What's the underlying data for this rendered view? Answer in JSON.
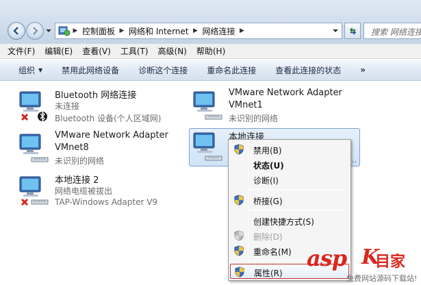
{
  "address_bar": {
    "crumbs": [
      "控制面板",
      "网络和 Internet",
      "网络连接"
    ],
    "search_placeholder": "搜索 网络连接"
  },
  "menubar": {
    "items": [
      "文件(F)",
      "编辑(E)",
      "查看(V)",
      "工具(T)",
      "高级(N)",
      "帮助(H)"
    ]
  },
  "command_bar": {
    "items": [
      "组织",
      "禁用此网络设备",
      "诊断这个连接",
      "重命名此连接",
      "查看此连接的状态"
    ],
    "more": "»"
  },
  "connections": [
    {
      "name": "Bluetooth 网络连接",
      "line2": "未连接",
      "line3": "Bluetooth 设备(个人区域网)",
      "status": "disconnected",
      "badge": "bluetooth-icon"
    },
    {
      "name": "VMware Network Adapter",
      "line2": "VMnet1",
      "line3": "未识别的网络",
      "status": "connected"
    },
    {
      "name": "VMware Network Adapter",
      "line2": "VMnet8",
      "line3": "未识别的网络",
      "status": "connected"
    },
    {
      "name": "本地连接",
      "line2": "",
      "line3": "",
      "status": "connected",
      "selected": true,
      "ellipsis": "..."
    },
    {
      "name": "本地连接 2",
      "line2": "网络电缆被拔出",
      "line3": "TAP-Windows Adapter V9",
      "status": "disconnected"
    }
  ],
  "context_menu": {
    "items": [
      {
        "label": "禁用(B)",
        "shield": true,
        "bold": false,
        "disabled": false
      },
      {
        "label": "状态(U)",
        "shield": false,
        "bold": true,
        "disabled": false
      },
      {
        "label": "诊断(I)",
        "shield": false,
        "bold": false,
        "disabled": false
      },
      {
        "label": "桥接(G)",
        "shield": true,
        "bold": false,
        "disabled": false
      },
      {
        "label": "创建快捷方式(S)",
        "shield": false,
        "bold": false,
        "disabled": false
      },
      {
        "label": "删除(D)",
        "shield": true,
        "bold": false,
        "disabled": true
      },
      {
        "label": "重命名(M)",
        "shield": true,
        "bold": false,
        "disabled": false
      },
      {
        "label": "属性(R)",
        "shield": true,
        "bold": false,
        "disabled": false,
        "highlighted": true
      }
    ]
  },
  "watermark": {
    "brand": "asp",
    "k": "K",
    "cn": "目家",
    "sub": "免费网站源码下载站!"
  },
  "colors": {
    "accent": "#d8281e",
    "selection": "#cfe3f8",
    "highlight_border": "#c4312b"
  }
}
